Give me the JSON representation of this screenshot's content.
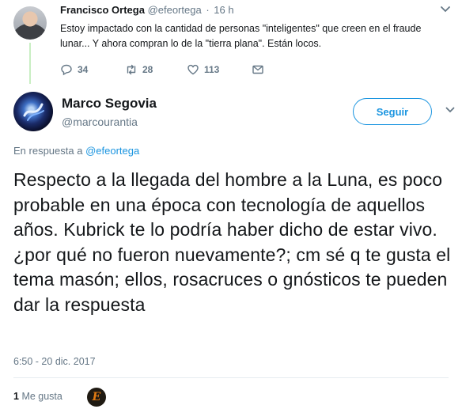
{
  "parent_tweet": {
    "name": "Francisco Ortega",
    "handle": "@efeortega",
    "separator": "·",
    "time": "16 h",
    "text": "Estoy impactado con la cantidad de personas \"inteligentes\" que creen en el fraude lunar... Y ahora compran lo de la \"tierra plana\". Están locos.",
    "replies": "34",
    "retweets": "28",
    "likes": "113",
    "icons": [
      "reply-icon",
      "retweet-icon",
      "heart-icon",
      "mail-icon",
      "chevron-down-icon"
    ]
  },
  "main_tweet": {
    "name": "Marco Segovia",
    "handle": "@marcourantia",
    "follow_label": "Seguir",
    "reply_prefix": "En respuesta a",
    "reply_to": "@efeortega",
    "text": "Respecto a la llegada del hombre a la Luna, es poco probable en una época con tecnología de aquellos años. Kubrick te lo podría haber dicho de estar vivo. ¿por qué no fueron nuevamente?; cm sé q te gusta el tema masón; ellos, rosacruces o gnósticos te pueden dar la respuesta",
    "date": "6:50 - 20 dic. 2017",
    "like_count": "1",
    "like_label": "Me gusta",
    "liker_initial": "E"
  },
  "colors": {
    "accent": "#1b95e0",
    "muted": "#657786",
    "thread_line": "#c9eec3",
    "text": "#14171a"
  }
}
